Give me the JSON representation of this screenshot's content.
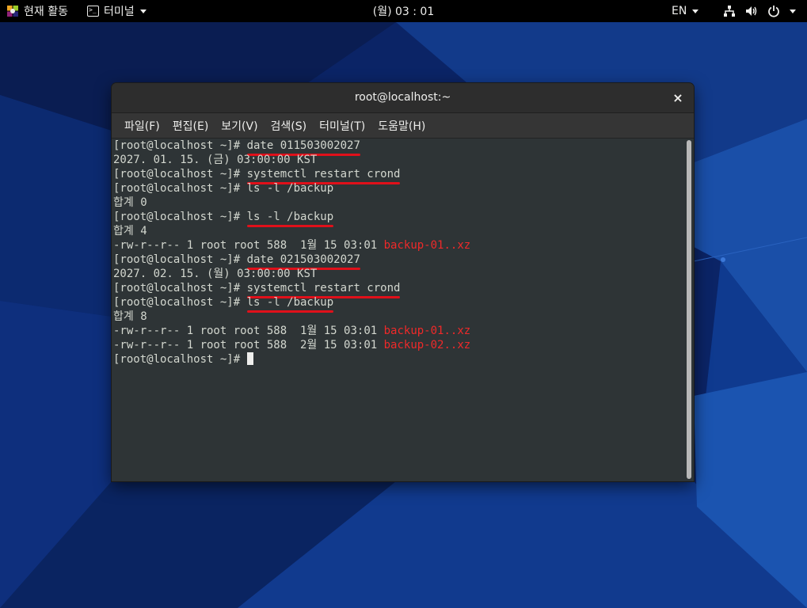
{
  "topbar": {
    "activities_label": "현재 활동",
    "app_menu_label": "터미널",
    "clock": "(월) 03 : 01",
    "language": "EN",
    "icons": [
      "network-icon",
      "volume-icon",
      "power-icon"
    ]
  },
  "window": {
    "title": "root@localhost:~",
    "close_glyph": "×",
    "menu": [
      "파일(F)",
      "편집(E)",
      "보기(V)",
      "검색(S)",
      "터미널(T)",
      "도움말(H)"
    ]
  },
  "terminal": {
    "lines": [
      {
        "prefix": "[root@localhost ~]# ",
        "cmd": "date 011503002027",
        "underlined": true
      },
      {
        "text": "2027. 01. 15. (금) 03:00:00 KST"
      },
      {
        "prefix": "[root@localhost ~]# ",
        "cmd": "systemctl restart crond",
        "underlined": true
      },
      {
        "prefix": "[root@localhost ~]# ",
        "cmd": "ls -l /backup",
        "underlined": false
      },
      {
        "text": "합계 0"
      },
      {
        "prefix": "[root@localhost ~]# ",
        "cmd": "ls -l /backup",
        "underlined": true
      },
      {
        "text": "합계 4"
      },
      {
        "text": "-rw-r--r-- 1 root root 588  1월 15 03:01 ",
        "file": "backup-01..xz"
      },
      {
        "prefix": "[root@localhost ~]# ",
        "cmd": "date 021503002027",
        "underlined": true
      },
      {
        "text": "2027. 02. 15. (월) 03:00:00 KST"
      },
      {
        "prefix": "[root@localhost ~]# ",
        "cmd": "systemctl restart crond",
        "underlined": true
      },
      {
        "prefix": "[root@localhost ~]# ",
        "cmd": "ls -l /backup",
        "underlined": true
      },
      {
        "text": "합계 8"
      },
      {
        "text": "-rw-r--r-- 1 root root 588  1월 15 03:01 ",
        "file": "backup-01..xz"
      },
      {
        "text": "-rw-r--r-- 1 root root 588  2월 15 03:01 ",
        "file": "backup-02..xz"
      },
      {
        "prefix": "[root@localhost ~]# ",
        "cmd": "",
        "cursor": true
      }
    ]
  },
  "colors": {
    "terminal_bg": "#2e3436",
    "terminal_fg": "#d3d7cf",
    "filename": "#ef2929",
    "annotation_underline": "#e0101a"
  }
}
